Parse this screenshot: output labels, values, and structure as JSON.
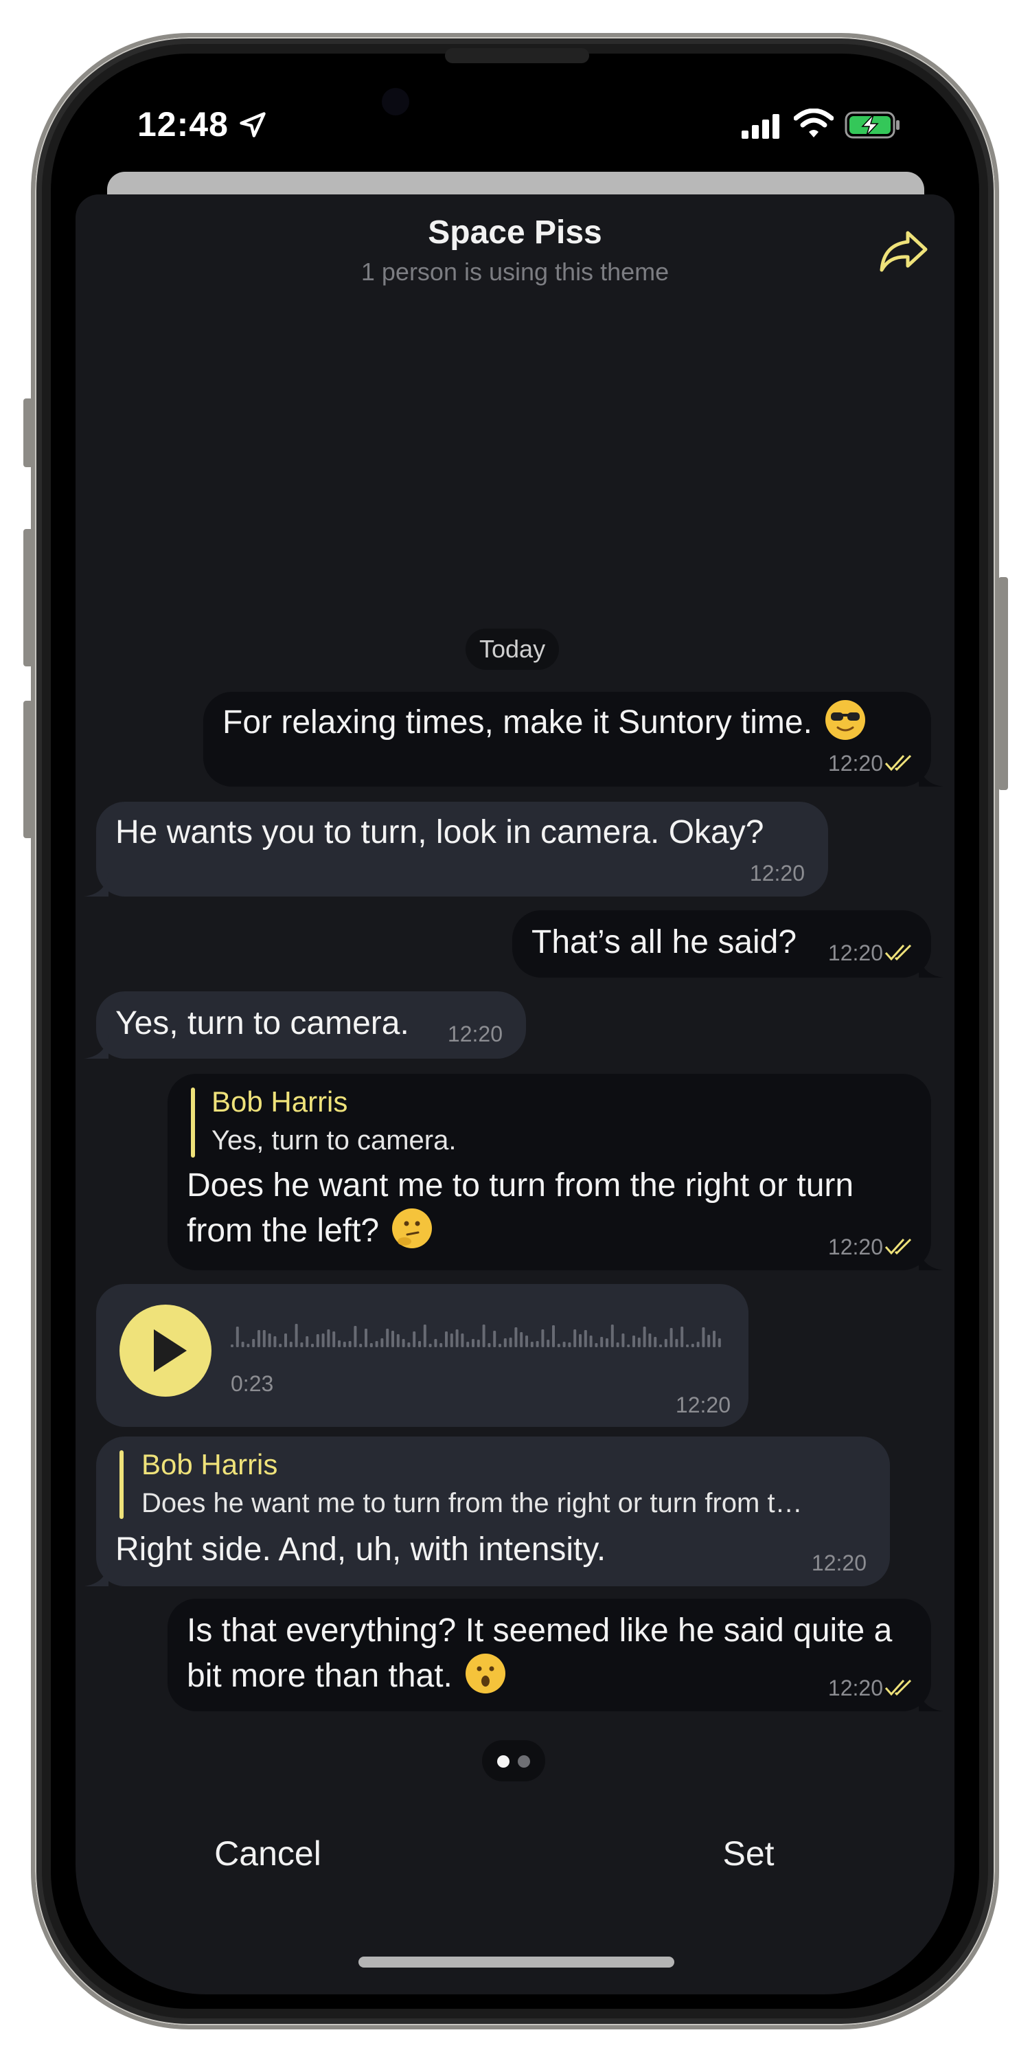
{
  "status_bar": {
    "time": "12:48"
  },
  "sheet": {
    "title": "Space Piss",
    "subtitle": "1 person is using this theme",
    "date_label": "Today"
  },
  "messages": [
    {
      "direction": "out",
      "text": "For relaxing times, make it Suntory time.",
      "emoji": "sunglasses-emoji",
      "time": "12:20",
      "read": true
    },
    {
      "direction": "in",
      "text": "He wants you to turn, look in camera. Okay?",
      "time": "12:20"
    },
    {
      "direction": "out",
      "text": "That’s all he said?",
      "time": "12:20",
      "read": true
    },
    {
      "direction": "in",
      "text": "Yes, turn to camera.",
      "time": "12:20"
    },
    {
      "direction": "out",
      "reply_name": "Bob Harris",
      "reply_text": "Yes, turn to camera.",
      "text": "Does he want me to turn from the right or turn from the left?",
      "emoji": "thinking-face-emoji",
      "time": "12:20",
      "read": true
    },
    {
      "direction": "in",
      "type": "voice",
      "duration": "0:23",
      "time": "12:20"
    },
    {
      "direction": "in",
      "reply_name": "Bob Harris",
      "reply_text": "Does he want me to turn from the right or turn from t…",
      "text": "Right side. And, uh, with intensity.",
      "time": "12:20"
    },
    {
      "direction": "out",
      "text": "Is that everything? It seemed like he said quite a bit more than that.",
      "emoji": "hushed-face-emoji",
      "time": "12:20",
      "read": true
    }
  ],
  "pager": {
    "pages": 2,
    "current": 1
  },
  "buttons": {
    "cancel": "Cancel",
    "set": "Set"
  },
  "colors": {
    "accent": "#efe27a",
    "sheet_bg": "#17181c",
    "incoming_bubble": "#272a33",
    "outgoing_bubble": "#0d0e12"
  }
}
